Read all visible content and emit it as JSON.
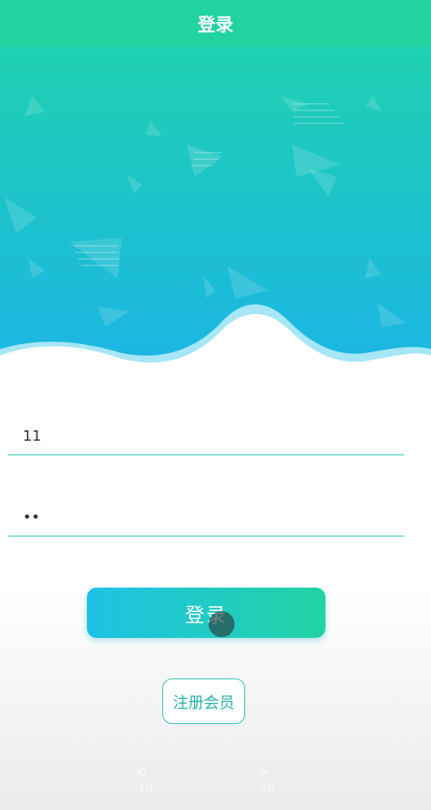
{
  "header": {
    "title": "登录"
  },
  "form": {
    "username_value": "11",
    "password_value": "••",
    "login_label": "登录",
    "register_label": "注册会员"
  },
  "video_controls": {
    "rewind_seconds": "10",
    "forward_seconds": "30"
  },
  "colors": {
    "header": "#22d3a0",
    "gradient_top": "#1fd0b2",
    "gradient_bottom": "#1bb6e4",
    "accent_line": "#26c1b0",
    "button_from": "#1ec2e6",
    "button_to": "#22d3a4"
  }
}
